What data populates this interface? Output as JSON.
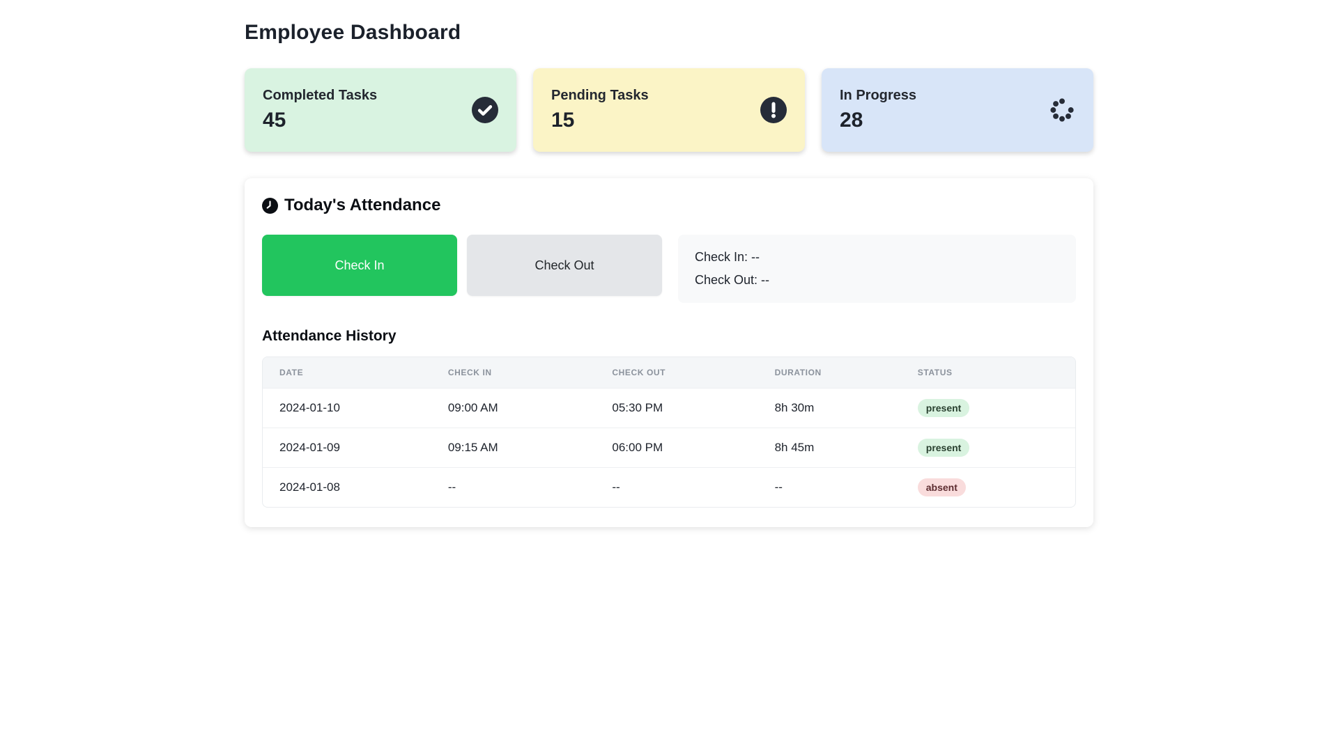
{
  "page": {
    "title": "Employee Dashboard"
  },
  "colors": {
    "card_completed_bg": "#d9f3e1",
    "card_pending_bg": "#fbf4c6",
    "card_inprogress_bg": "#d8e5f8",
    "icon_dark": "#262c38",
    "check_in_button_bg": "#22c55e",
    "check_out_button_bg": "#e4e6e9",
    "status_panel_bg": "#f8f9fa",
    "present_badge_bg": "#d9f3e0",
    "present_badge_text": "#29402f",
    "absent_badge_bg": "#f9dcdc",
    "absent_badge_text": "#5d2c30"
  },
  "stats": {
    "cards": [
      {
        "label": "Completed Tasks",
        "value": "45",
        "icon": "check-circle"
      },
      {
        "label": "Pending Tasks",
        "value": "15",
        "icon": "exclamation-circle"
      },
      {
        "label": "In Progress",
        "value": "28",
        "icon": "spinner"
      }
    ]
  },
  "attendance": {
    "heading": "Today's Attendance",
    "heading_icon": "clock",
    "check_in_button": "Check In",
    "check_out_button": "Check Out",
    "status_panel": {
      "check_in_line": "Check In: --",
      "check_out_line": "Check Out: --"
    }
  },
  "history": {
    "heading": "Attendance History",
    "columns": [
      "DATE",
      "CHECK IN",
      "CHECK OUT",
      "DURATION",
      "STATUS"
    ],
    "rows": [
      {
        "date": "2024-01-10",
        "check_in": "09:00 AM",
        "check_out": "05:30 PM",
        "duration": "8h 30m",
        "status": "present"
      },
      {
        "date": "2024-01-09",
        "check_in": "09:15 AM",
        "check_out": "06:00 PM",
        "duration": "8h 45m",
        "status": "present"
      },
      {
        "date": "2024-01-08",
        "check_in": "--",
        "check_out": "--",
        "duration": "--",
        "status": "absent"
      }
    ]
  }
}
